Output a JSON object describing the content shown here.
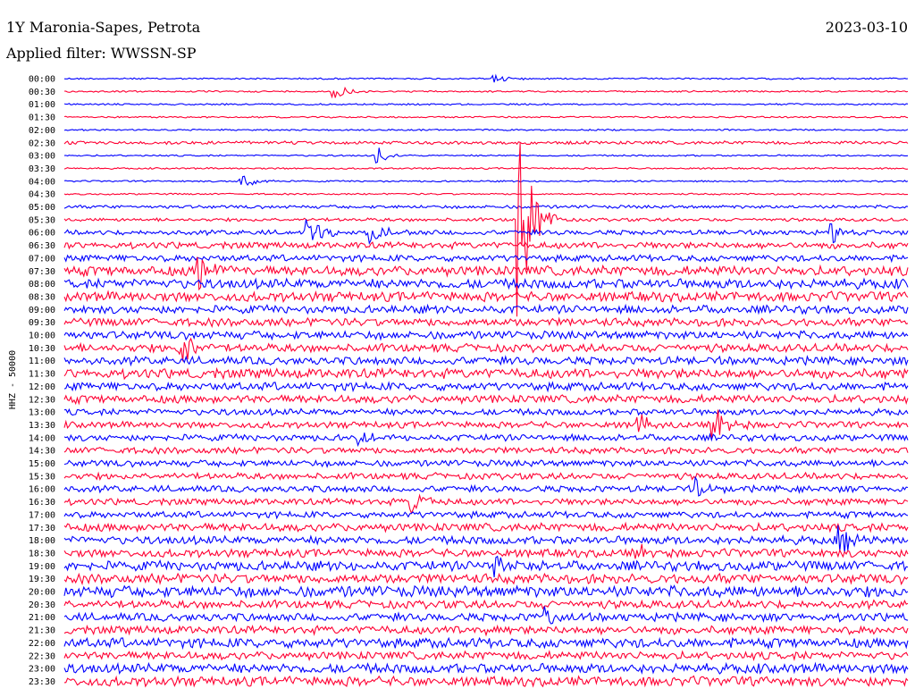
{
  "header": {
    "station": "1Y Maronia-Sapes, Petrota",
    "date": "2023-03-10",
    "filter": "Applied filter: WWSSN-SP"
  },
  "chart_data": {
    "type": "line",
    "title": "1Y Maronia-Sapes, Petrota",
    "ylabel": "HHZ - 50000",
    "colors": [
      "#0000ff",
      "#ff0033"
    ],
    "rows": [
      "00:00",
      "00:30",
      "01:00",
      "01:30",
      "02:00",
      "02:30",
      "03:00",
      "03:30",
      "04:00",
      "04:30",
      "05:00",
      "05:30",
      "06:00",
      "06:30",
      "07:00",
      "07:30",
      "08:00",
      "08:30",
      "09:00",
      "09:30",
      "10:00",
      "10:30",
      "11:00",
      "11:30",
      "12:00",
      "12:30",
      "13:00",
      "13:30",
      "14:00",
      "14:30",
      "15:00",
      "15:30",
      "16:00",
      "16:30",
      "17:00",
      "17:30",
      "18:00",
      "18:30",
      "19:00",
      "19:30",
      "20:00",
      "20:30",
      "21:00",
      "21:30",
      "22:00",
      "22:30",
      "23:00",
      "23:30"
    ],
    "noise_level": [
      1,
      1,
      1,
      1,
      1,
      2,
      1,
      1,
      1,
      1,
      2,
      2,
      3,
      4,
      4,
      6,
      6,
      6,
      5,
      5,
      5,
      5,
      5,
      6,
      5,
      5,
      4,
      4,
      4,
      4,
      4,
      4,
      4,
      4,
      4,
      5,
      5,
      5,
      6,
      6,
      7,
      5,
      5,
      5,
      6,
      5,
      6,
      6
    ],
    "events": [
      {
        "row": "00:00",
        "x": 0.51,
        "amp": 6
      },
      {
        "row": "00:30",
        "x": 0.32,
        "amp": 10
      },
      {
        "row": "03:00",
        "x": 0.37,
        "amp": 10
      },
      {
        "row": "04:00",
        "x": 0.21,
        "amp": 10
      },
      {
        "row": "05:30",
        "x": 0.54,
        "amp": 120
      },
      {
        "row": "06:00",
        "x": 0.29,
        "amp": 16
      },
      {
        "row": "06:00",
        "x": 0.36,
        "amp": 18
      },
      {
        "row": "06:00",
        "x": 0.91,
        "amp": 12
      },
      {
        "row": "07:30",
        "x": 0.16,
        "amp": 25
      },
      {
        "row": "10:30",
        "x": 0.14,
        "amp": 18
      },
      {
        "row": "13:30",
        "x": 0.68,
        "amp": 14
      },
      {
        "row": "13:30",
        "x": 0.77,
        "amp": 25
      },
      {
        "row": "14:00",
        "x": 0.35,
        "amp": 12
      },
      {
        "row": "16:00",
        "x": 0.75,
        "amp": 12
      },
      {
        "row": "16:30",
        "x": 0.41,
        "amp": 18
      },
      {
        "row": "18:00",
        "x": 0.92,
        "amp": 20
      },
      {
        "row": "18:30",
        "x": 0.68,
        "amp": 12
      },
      {
        "row": "19:00",
        "x": 0.51,
        "amp": 14
      },
      {
        "row": "21:00",
        "x": 0.57,
        "amp": 12
      },
      {
        "row": "21:30",
        "x": 0.49,
        "amp": 10
      }
    ]
  }
}
